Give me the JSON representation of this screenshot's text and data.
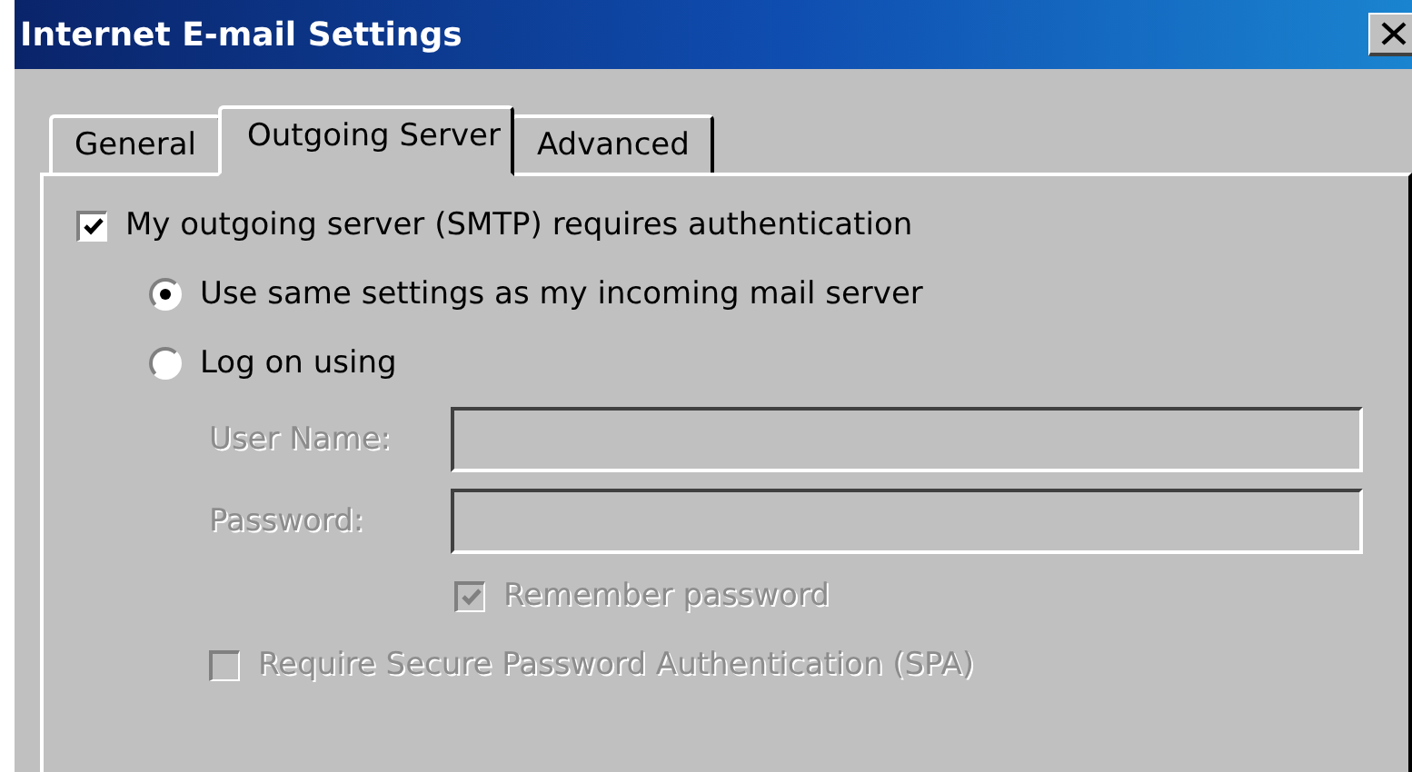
{
  "window": {
    "title": "Internet E-mail Settings"
  },
  "tabs": [
    {
      "label": "General",
      "selected": false
    },
    {
      "label": "Outgoing Server",
      "selected": true
    },
    {
      "label": "Advanced",
      "selected": false
    }
  ],
  "requires_auth": {
    "label": "My outgoing server (SMTP) requires authentication",
    "checked": true
  },
  "login_options": [
    {
      "label": "Use same settings as my incoming mail server",
      "selected": true
    },
    {
      "label": "Log on using",
      "selected": false
    }
  ],
  "fields": [
    {
      "label": "User Name:",
      "disabled": true
    },
    {
      "label": "Password:",
      "disabled": true
    }
  ],
  "remember_password": {
    "label": "Remember password",
    "checked": true,
    "disabled": true
  },
  "require_spa": {
    "label": "Require Secure Password Authentication (SPA)",
    "checked": false,
    "disabled": true
  }
}
